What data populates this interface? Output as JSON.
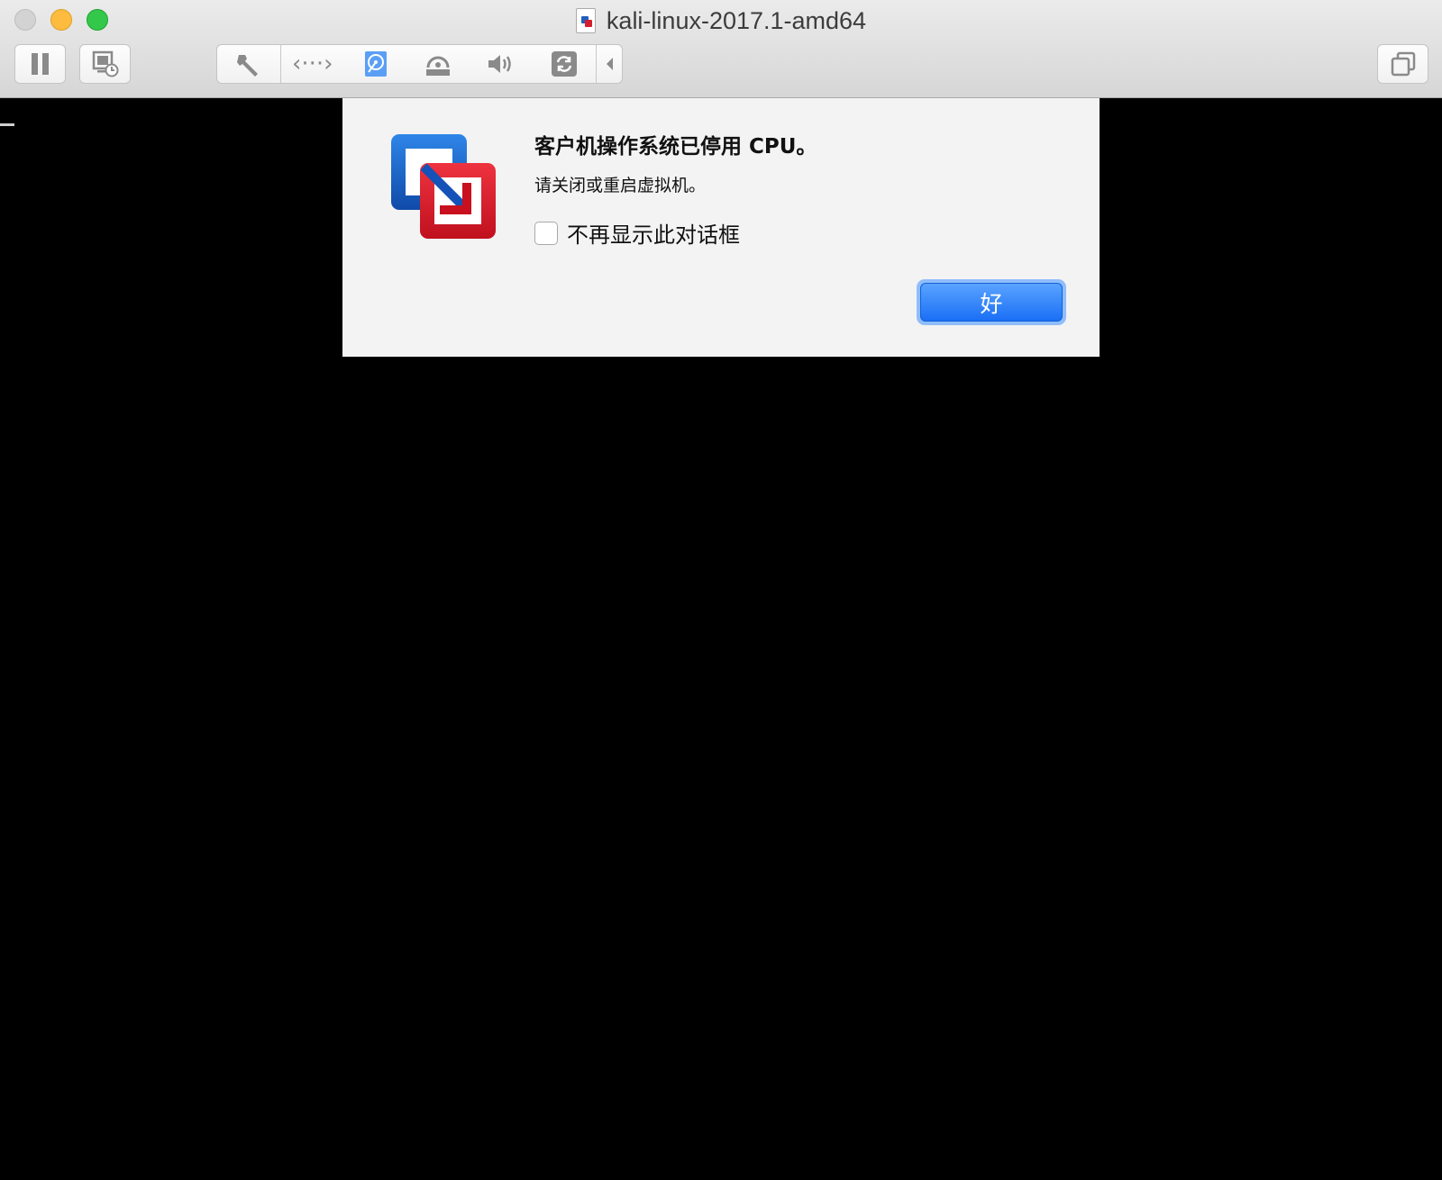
{
  "window": {
    "title": "kali-linux-2017.1-amd64"
  },
  "toolbar": {
    "icons": [
      "pause-icon",
      "snapshot-icon",
      "wrench-icon",
      "network-icon",
      "hard-disk-icon",
      "optical-drive-icon",
      "speaker-icon",
      "usb-sync-icon",
      "collapse-arrow-icon",
      "restore-window-icon"
    ]
  },
  "dialog": {
    "title": "客户机操作系统已停用 CPU。",
    "message": "请关闭或重启虚拟机。",
    "checkbox_label": "不再显示此对话框",
    "checkbox_checked": false,
    "ok_label": "好",
    "ok_color": "#1a6ff5"
  },
  "colors": {
    "traffic_close": "#d3d3d3",
    "traffic_minimize": "#fdbc40",
    "traffic_maximize": "#34c84a",
    "console_bg": "#000000"
  }
}
